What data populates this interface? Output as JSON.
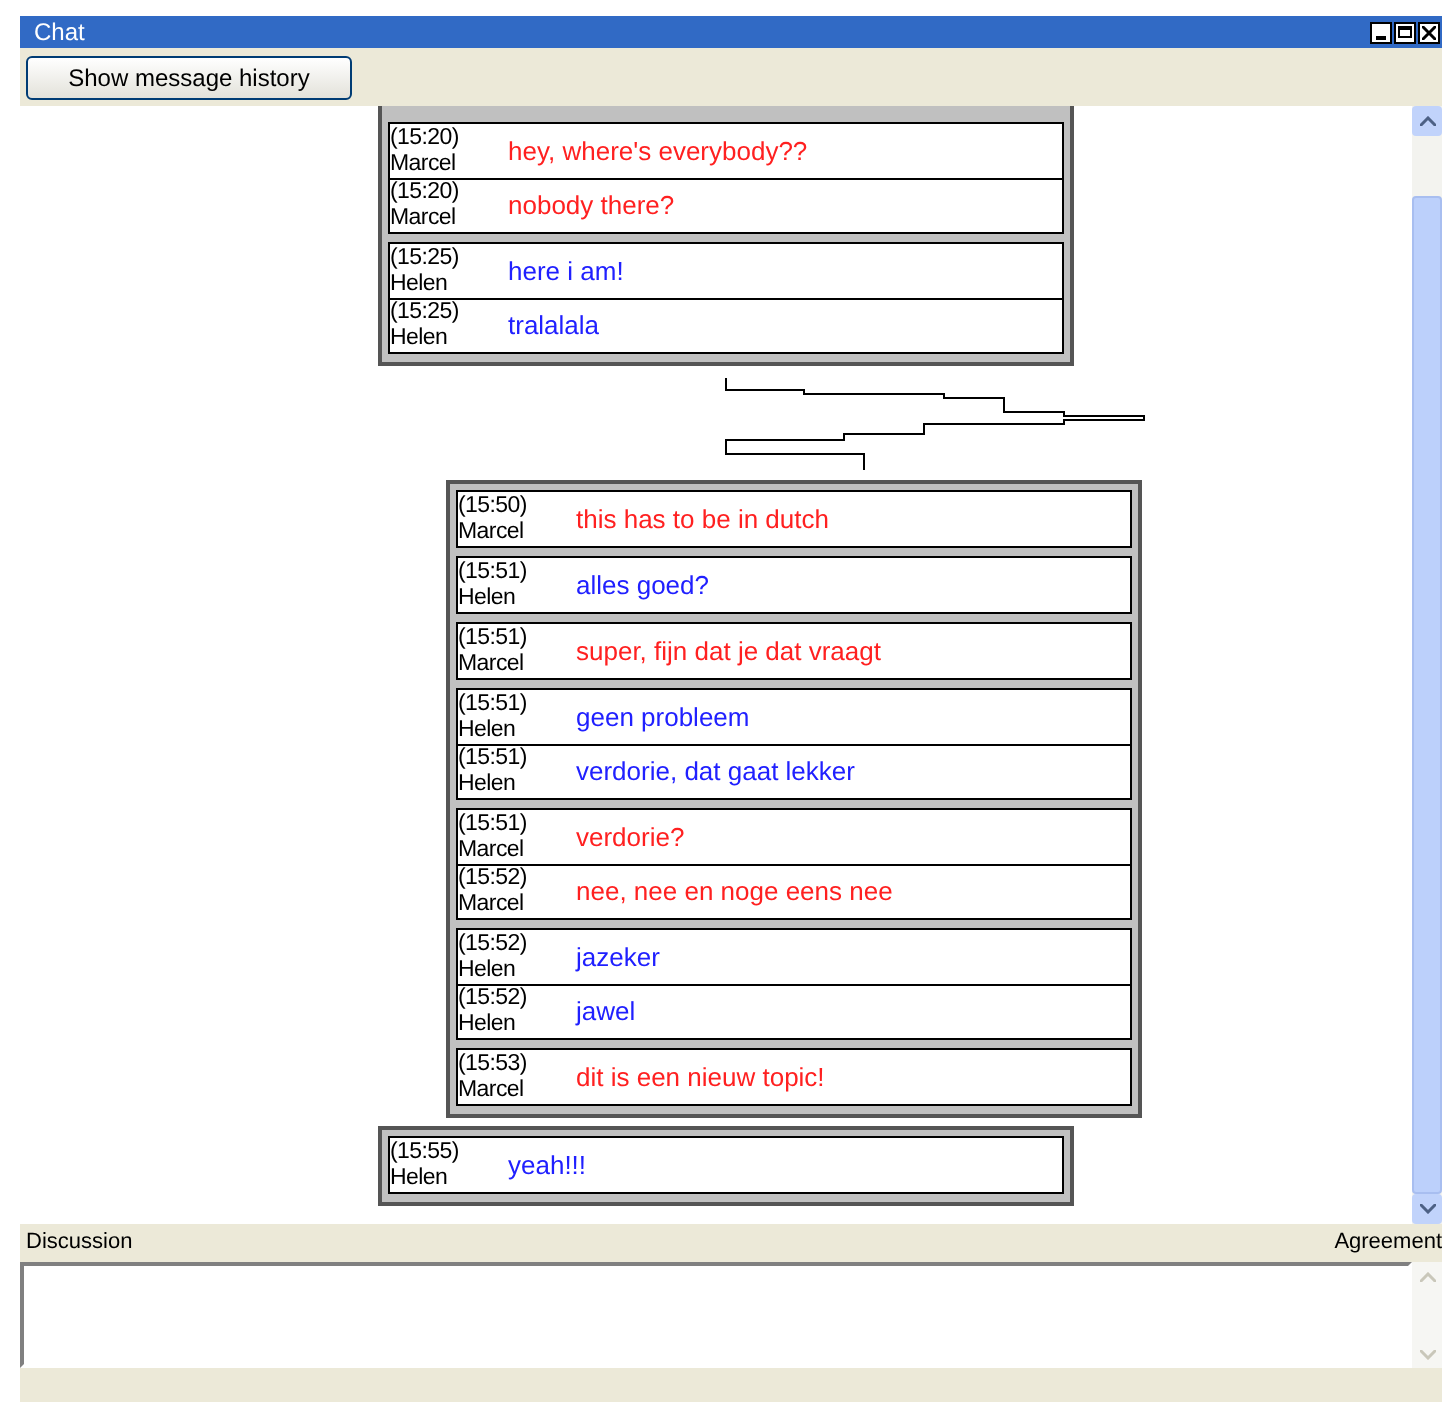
{
  "window": {
    "title": "Chat"
  },
  "toolbar": {
    "history_button": "Show message history"
  },
  "groups": [
    {
      "kind": "flush",
      "threads": [
        {
          "color": "#ff2020",
          "messages": [
            {
              "time": "(15:20)",
              "author": "Marcel",
              "text": "hey, where's everybody??"
            },
            {
              "time": "(15:20)",
              "author": "Marcel",
              "text": "nobody there?"
            }
          ]
        },
        {
          "color": "#2020ff",
          "messages": [
            {
              "time": "(15:25)",
              "author": "Helen",
              "text": "here i am!"
            },
            {
              "time": "(15:25)",
              "author": "Helen",
              "text": "tralalala"
            }
          ]
        }
      ]
    },
    {
      "kind": "indented",
      "threads": [
        {
          "color": "#ff2020",
          "messages": [
            {
              "time": "(15:50)",
              "author": "Marcel",
              "text": "this has to be in dutch"
            }
          ]
        },
        {
          "color": "#2020ff",
          "messages": [
            {
              "time": "(15:51)",
              "author": "Helen",
              "text": "alles goed?"
            }
          ]
        },
        {
          "color": "#ff2020",
          "messages": [
            {
              "time": "(15:51)",
              "author": "Marcel",
              "text": "super, fijn dat je dat vraagt"
            }
          ]
        },
        {
          "color": "#2020ff",
          "messages": [
            {
              "time": "(15:51)",
              "author": "Helen",
              "text": "geen probleem"
            },
            {
              "time": "(15:51)",
              "author": "Helen",
              "text": "verdorie, dat gaat lekker"
            }
          ]
        },
        {
          "color": "#ff2020",
          "messages": [
            {
              "time": "(15:51)",
              "author": "Marcel",
              "text": "verdorie?"
            },
            {
              "time": "(15:52)",
              "author": "Marcel",
              "text": "nee, nee en noge eens nee"
            }
          ]
        },
        {
          "color": "#2020ff",
          "messages": [
            {
              "time": "(15:52)",
              "author": "Helen",
              "text": "jazeker"
            },
            {
              "time": "(15:52)",
              "author": "Helen",
              "text": "jawel"
            }
          ]
        },
        {
          "color": "#ff2020",
          "messages": [
            {
              "time": "(15:53)",
              "author": "Marcel",
              "text": "dit is een nieuw topic!"
            }
          ]
        }
      ]
    },
    {
      "kind": "flush",
      "threads": [
        {
          "color": "#2020ff",
          "messages": [
            {
              "time": "(15:55)",
              "author": "Helen",
              "text": "yeah!!!"
            }
          ]
        }
      ]
    }
  ],
  "discussion": {
    "label": "Discussion",
    "agreement_label": "Agreement"
  }
}
